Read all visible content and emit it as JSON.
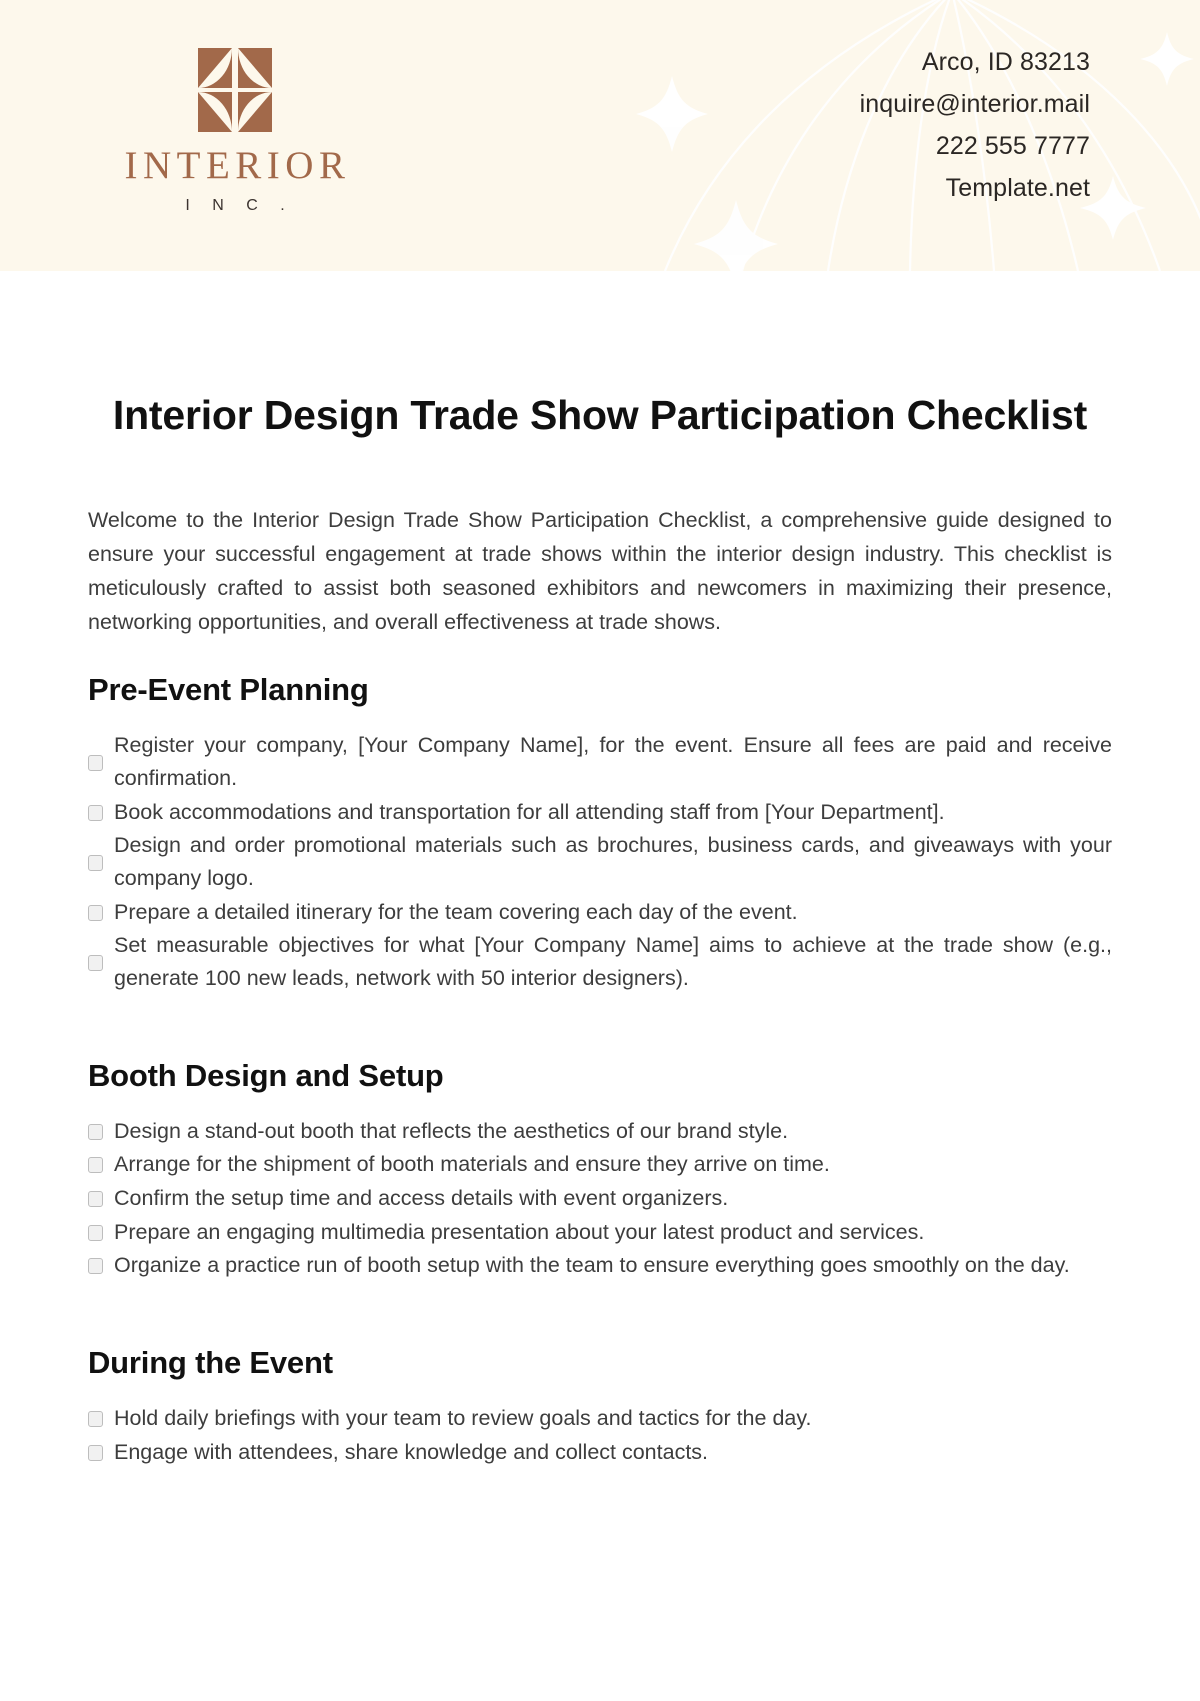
{
  "brand": {
    "logo_mark": "interior-square-petal-mark",
    "name": "INTERIOR",
    "suffix": "I N C .",
    "accent_color": "#a2694a",
    "header_bg": "#fdf8ec"
  },
  "header": {
    "decoration": "globe-meridian-lines-with-sparkles",
    "contact": [
      "Arco, ID 83213",
      "inquire@interior.mail",
      "222 555 7777",
      "Template.net"
    ]
  },
  "document": {
    "title": "Interior Design Trade Show Participation Checklist",
    "intro": "Welcome to the Interior Design Trade Show Participation Checklist, a comprehensive guide designed to ensure your successful engagement at trade shows within the interior design industry. This checklist is meticulously crafted to assist both seasoned exhibitors and newcomers in maximizing their presence, networking opportunities, and overall effectiveness at trade shows.",
    "sections": [
      {
        "heading": "Pre-Event Planning",
        "items": [
          "Register your company, [Your Company Name], for the event. Ensure all fees are paid and receive confirmation.",
          "Book accommodations and transportation for all attending staff from [Your Department].",
          "Design and order promotional materials such as brochures, business cards, and giveaways with your company logo.",
          "Prepare a detailed itinerary for the team covering each day of the event.",
          "Set measurable objectives for what [Your Company Name] aims to achieve at the trade show (e.g., generate 100 new leads, network with 50 interior designers)."
        ]
      },
      {
        "heading": "Booth Design and Setup",
        "items": [
          "Design a stand-out booth that reflects the aesthetics of our brand style.",
          "Arrange for the shipment of booth materials and ensure they arrive on time.",
          "Confirm the setup time and access details with event organizers.",
          "Prepare an engaging multimedia presentation about your latest product and services.",
          "Organize a practice run of booth setup with the team to ensure everything goes smoothly on the day."
        ]
      },
      {
        "heading": "During the Event",
        "items": [
          "Hold daily briefings with your team to review goals and tactics for the day.",
          "Engage with attendees, share knowledge and collect contacts."
        ]
      }
    ]
  }
}
